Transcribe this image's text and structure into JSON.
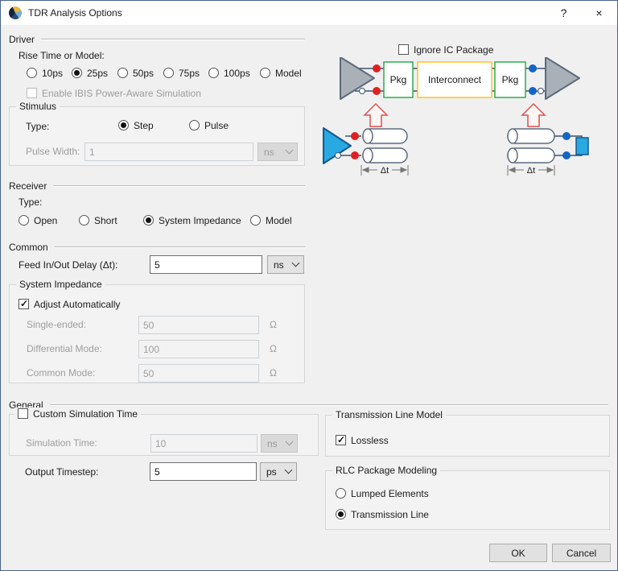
{
  "window": {
    "title": "TDR Analysis Options",
    "help": "?",
    "close": "×"
  },
  "driver": {
    "section": "Driver",
    "rise_time_label": "Rise Time or Model:",
    "rise_time_options": [
      {
        "label": "10ps",
        "selected": false
      },
      {
        "label": "25ps",
        "selected": true
      },
      {
        "label": "50ps",
        "selected": false
      },
      {
        "label": "75ps",
        "selected": false
      },
      {
        "label": "100ps",
        "selected": false
      },
      {
        "label": "Model",
        "selected": false
      }
    ],
    "ibis_checkbox": {
      "label": "Enable IBIS Power-Aware Simulation",
      "checked": false,
      "enabled": false
    }
  },
  "stimulus": {
    "group": "Stimulus",
    "type_label": "Type:",
    "type_options": [
      {
        "label": "Step",
        "selected": true
      },
      {
        "label": "Pulse",
        "selected": false
      }
    ],
    "pulse_width": {
      "label": "Pulse Width:",
      "value": "1",
      "unit": "ns",
      "enabled": false
    }
  },
  "receiver": {
    "section": "Receiver",
    "type_label": "Type:",
    "type_options": [
      {
        "label": "Open",
        "selected": false
      },
      {
        "label": "Short",
        "selected": false
      },
      {
        "label": "System Impedance",
        "selected": true
      },
      {
        "label": "Model",
        "selected": false
      }
    ]
  },
  "common": {
    "section": "Common",
    "feed_delay": {
      "label": "Feed In/Out Delay (Δt):",
      "value": "5",
      "unit": "ns"
    },
    "system_impedance": {
      "group": "System Impedance",
      "adjust_checkbox": {
        "label": "Adjust Automatically",
        "checked": true
      },
      "rows": [
        {
          "label": "Single-ended:",
          "value": "50",
          "unit": "Ω",
          "enabled": false
        },
        {
          "label": "Differential Mode:",
          "value": "100",
          "unit": "Ω",
          "enabled": false
        },
        {
          "label": "Common Mode:",
          "value": "50",
          "unit": "Ω",
          "enabled": false
        }
      ]
    }
  },
  "general": {
    "section": "General",
    "custom_simulation_time": {
      "group_checkbox": {
        "label": "Custom Simulation Time",
        "checked": false
      },
      "simulation_time": {
        "label": "Simulation Time:",
        "value": "10",
        "unit": "ns",
        "enabled": false
      }
    },
    "output_timestep": {
      "label": "Output Timestep:",
      "value": "5",
      "unit": "ps"
    },
    "transmission_line_model": {
      "group": "Transmission Line Model",
      "lossless_checkbox": {
        "label": "Lossless",
        "checked": true
      }
    },
    "rlc_package_modeling": {
      "group": "RLC Package Modeling",
      "options": [
        {
          "label": "Lumped Elements",
          "selected": false
        },
        {
          "label": "Transmission Line",
          "selected": true
        }
      ]
    }
  },
  "diagram": {
    "ignore_ic_checkbox": {
      "label": "Ignore IC Package",
      "checked": false
    },
    "pkg_label": "Pkg",
    "interconnect_label": "Interconnect",
    "delta_t_label": "Δt",
    "colors": {
      "wire": "#3b5272",
      "driver_dot": "#e02020",
      "receiver_dot": "#1565c4",
      "pkg_border": "#2ead4e",
      "interconnect_border": "#ffc423",
      "buffer_fill": "#a9b0b8",
      "driver_fill": "#29a9e1",
      "arrow": "#d9534f"
    }
  },
  "footer": {
    "ok": "OK",
    "cancel": "Cancel"
  }
}
